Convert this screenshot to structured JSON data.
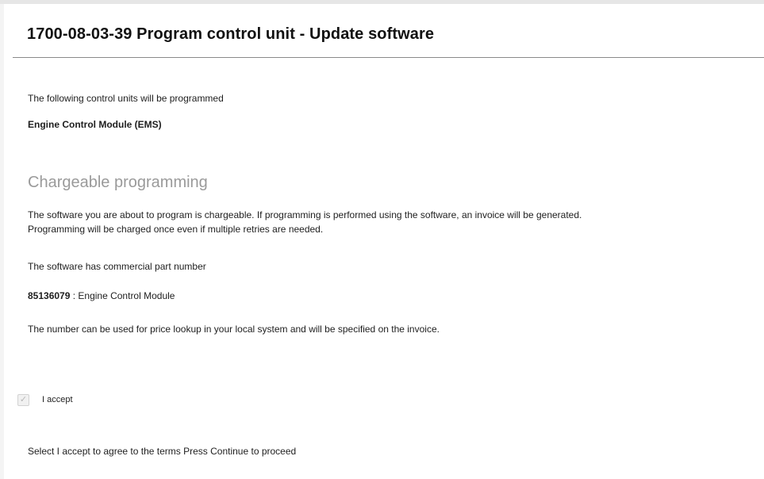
{
  "header": {
    "title": "1700-08-03-39 Program control unit - Update software"
  },
  "intro": {
    "text": "The following control units will be programmed",
    "control_unit": "Engine Control Module (EMS)"
  },
  "chargeable": {
    "title": "Chargeable programming",
    "line1": "The software you are about to program is chargeable. If programming is performed using the software, an invoice will be generated.",
    "line2": "Programming will be charged once even if multiple retries are needed.",
    "part_number_label": "The software has commercial part number",
    "part_number": "85136079",
    "part_description": " : Engine Control Module",
    "lookup_note": "The number can be used for price lookup in your local system and will be specified on the invoice."
  },
  "accept": {
    "checked": true,
    "checkmark": "✓",
    "label": "I accept"
  },
  "footer": {
    "instruction": "Select I accept to agree to the terms Press Continue to proceed"
  }
}
